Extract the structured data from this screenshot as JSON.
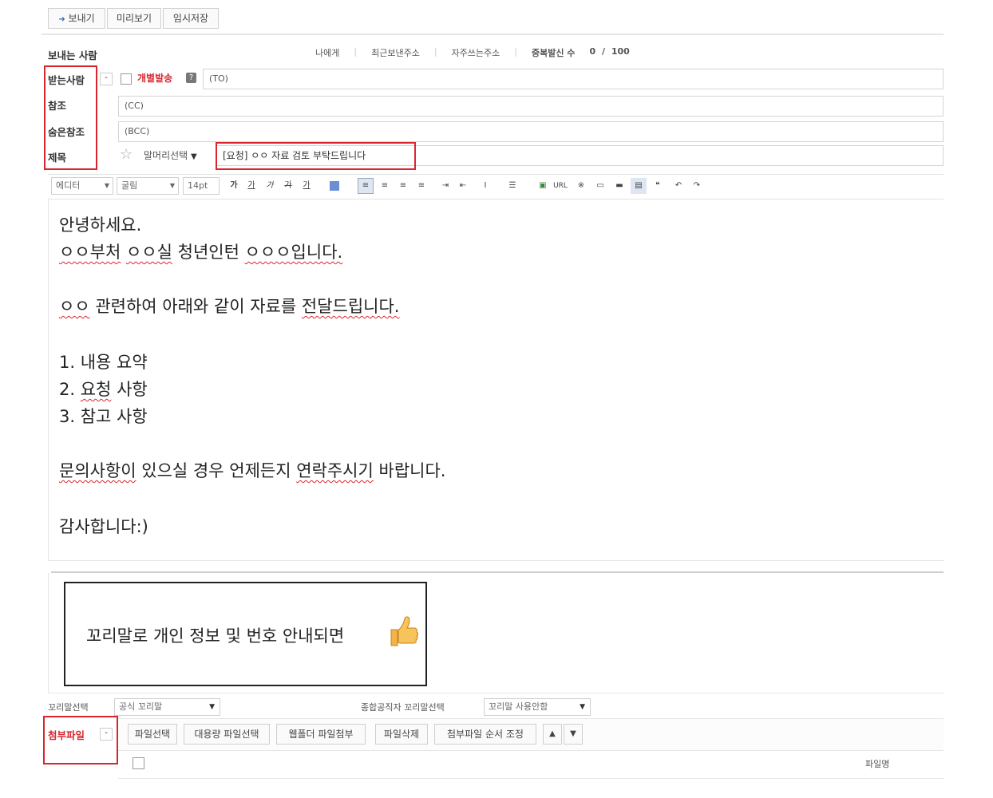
{
  "toolbar": {
    "send_label": "보내기",
    "preview_label": "미리보기",
    "save_draft_label": "임시저장"
  },
  "sender": {
    "label": "보내는 사람",
    "links": [
      "나에게",
      "최근보낸주소",
      "자주쓰는주소"
    ],
    "dup_label": "중복발신 수",
    "dup_count": "0",
    "dup_sep": "/",
    "dup_max": "100"
  },
  "to": {
    "label": "받는사람",
    "toggle": "-",
    "individual_label": "개별발송",
    "help": "?",
    "placeholder": "(TO)"
  },
  "cc": {
    "label": "참조",
    "placeholder": "(CC)"
  },
  "bcc": {
    "label": "숨은참조",
    "placeholder": "(BCC)"
  },
  "subject": {
    "label": "제목",
    "prefix_select": "말머리선택",
    "value": "[요청] ㅇㅇ 자료 검토 부탁드립니다"
  },
  "editor": {
    "mode": "에디터",
    "font": "굴림",
    "size": "14pt",
    "bold": "가",
    "underline": "가",
    "italic": "가",
    "strike": "가",
    "color": "가",
    "url": "URL"
  },
  "body": {
    "greeting": "안녕하세요.",
    "intro_p1": "ㅇㅇ부처",
    "intro_p2": "ㅇㅇ실",
    "intro_p3": "청년인턴",
    "intro_p4": "ㅇㅇㅇ입니다.",
    "line2_p1": "ㅇㅇ",
    "line2_p2": "관련하여 아래와 같이 자료를",
    "line2_p3": "전달드립니다.",
    "item1": "1. 내용 요약",
    "item2_p1": "2.",
    "item2_p2": "요청",
    "item2_p3": "사항",
    "item3": "3. 참고 사항",
    "contact_p1": "문의사항이",
    "contact_p2": "있으실 경우 언제든지",
    "contact_p3": "연락주시기",
    "contact_p4": "바랍니다.",
    "thanks": "감사합니다:)"
  },
  "callout": {
    "text": "꼬리말로 개인 정보 및 번호 안내되면"
  },
  "signature": {
    "label": "꼬리말선택",
    "value": "공식 꼬리말",
    "general_label": "종합공직자 꼬리말선택",
    "general_value": "꼬리말 사용안함"
  },
  "attachments": {
    "label": "첨부파일",
    "toggle": "-",
    "buttons": [
      "파일선택",
      "대용량 파일선택",
      "웹폴더 파일첨부",
      "파일삭제",
      "첨부파일 순서 조정"
    ],
    "up": "▲",
    "down": "▼",
    "column": "파일명"
  },
  "colors": {
    "highlight": "#d9262e",
    "accent": "#2b6cc4"
  }
}
